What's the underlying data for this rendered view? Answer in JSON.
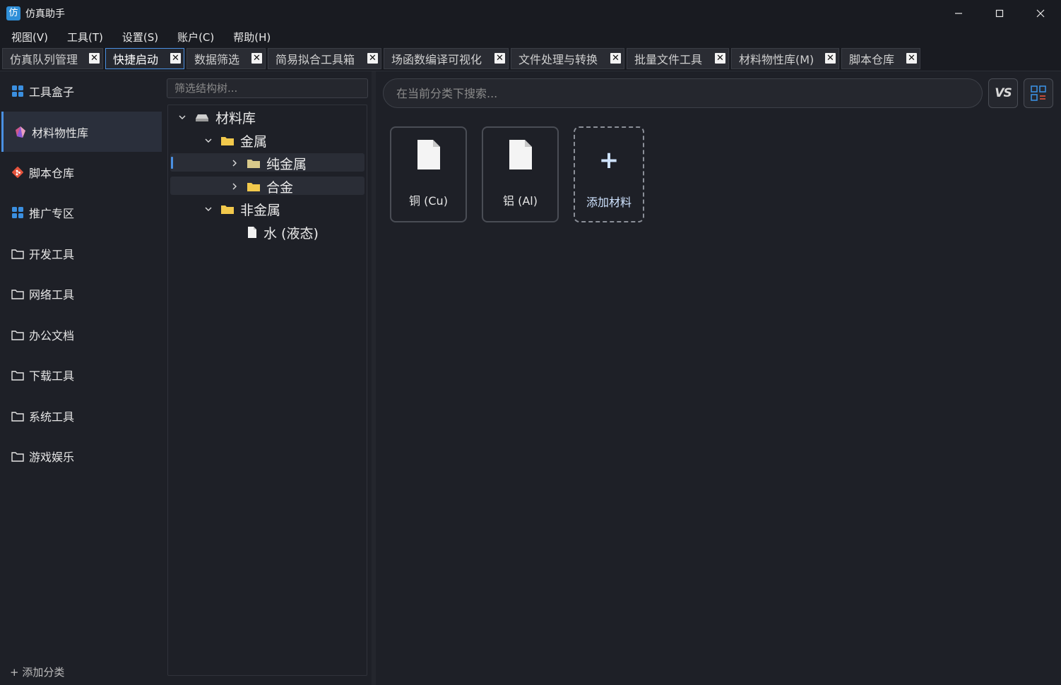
{
  "window": {
    "title": "仿真助手",
    "icon_glyph": "仿",
    "controls": [
      "minimize-icon",
      "maximize-icon",
      "close-icon"
    ]
  },
  "menu": [
    {
      "label": "视图(V)"
    },
    {
      "label": "工具(T)"
    },
    {
      "label": "设置(S)"
    },
    {
      "label": "账户(C)"
    },
    {
      "label": "帮助(H)"
    }
  ],
  "tabs": [
    {
      "label": "仿真队列管理",
      "active": false
    },
    {
      "label": "快捷启动",
      "active": true
    },
    {
      "label": "数据筛选",
      "active": false
    },
    {
      "label": "简易拟合工具箱",
      "active": false
    },
    {
      "label": "场函数编译可视化",
      "active": false
    },
    {
      "label": "文件处理与转换",
      "active": false
    },
    {
      "label": "批量文件工具",
      "active": false
    },
    {
      "label": "材料物性库(M)",
      "active": false
    },
    {
      "label": "脚本仓库",
      "active": false
    }
  ],
  "tab_close_glyph": "✕",
  "sidebar": {
    "items": [
      {
        "label": "工具盒子",
        "icon": "grid-icon",
        "active": false
      },
      {
        "label": "材料物性库",
        "icon": "crystal-icon",
        "active": true
      },
      {
        "label": "脚本仓库",
        "icon": "git-icon",
        "active": false
      },
      {
        "label": "推广专区",
        "icon": "grid-icon",
        "active": false
      },
      {
        "label": "开发工具",
        "icon": "folder-icon",
        "active": false
      },
      {
        "label": "网络工具",
        "icon": "folder-icon",
        "active": false
      },
      {
        "label": "办公文档",
        "icon": "folder-icon",
        "active": false
      },
      {
        "label": "下载工具",
        "icon": "folder-icon",
        "active": false
      },
      {
        "label": "系统工具",
        "icon": "folder-icon",
        "active": false
      },
      {
        "label": "游戏娱乐",
        "icon": "folder-icon",
        "active": false
      }
    ],
    "add_category": "+ 添加分类"
  },
  "tree": {
    "filter_placeholder": "筛选结构树...",
    "nodes": [
      {
        "label": "材料库",
        "level": 0,
        "expanded": true,
        "icon": "drive-icon"
      },
      {
        "label": "金属",
        "level": 1,
        "expanded": true,
        "icon": "folder-icon"
      },
      {
        "label": "纯金属",
        "level": 2,
        "expanded": false,
        "icon": "folder-icon",
        "selected": true
      },
      {
        "label": "合金",
        "level": 2,
        "expanded": false,
        "icon": "folder-icon"
      },
      {
        "label": "非金属",
        "level": 1,
        "expanded": true,
        "icon": "folder-icon"
      },
      {
        "label": "水 (液态)",
        "level": 2,
        "icon": "file-icon"
      }
    ]
  },
  "main": {
    "search_placeholder": "在当前分类下搜索...",
    "vs_button_label": "VS",
    "cards": [
      {
        "label": "铜 (Cu)",
        "icon": "document-icon"
      },
      {
        "label": "铝 (Al)",
        "icon": "document-icon"
      }
    ],
    "add_card": {
      "label": "添加材料",
      "glyph": "+"
    }
  },
  "colors": {
    "accent": "#4a90e2",
    "folder": "#f2c94c",
    "background": "#1e2027"
  }
}
